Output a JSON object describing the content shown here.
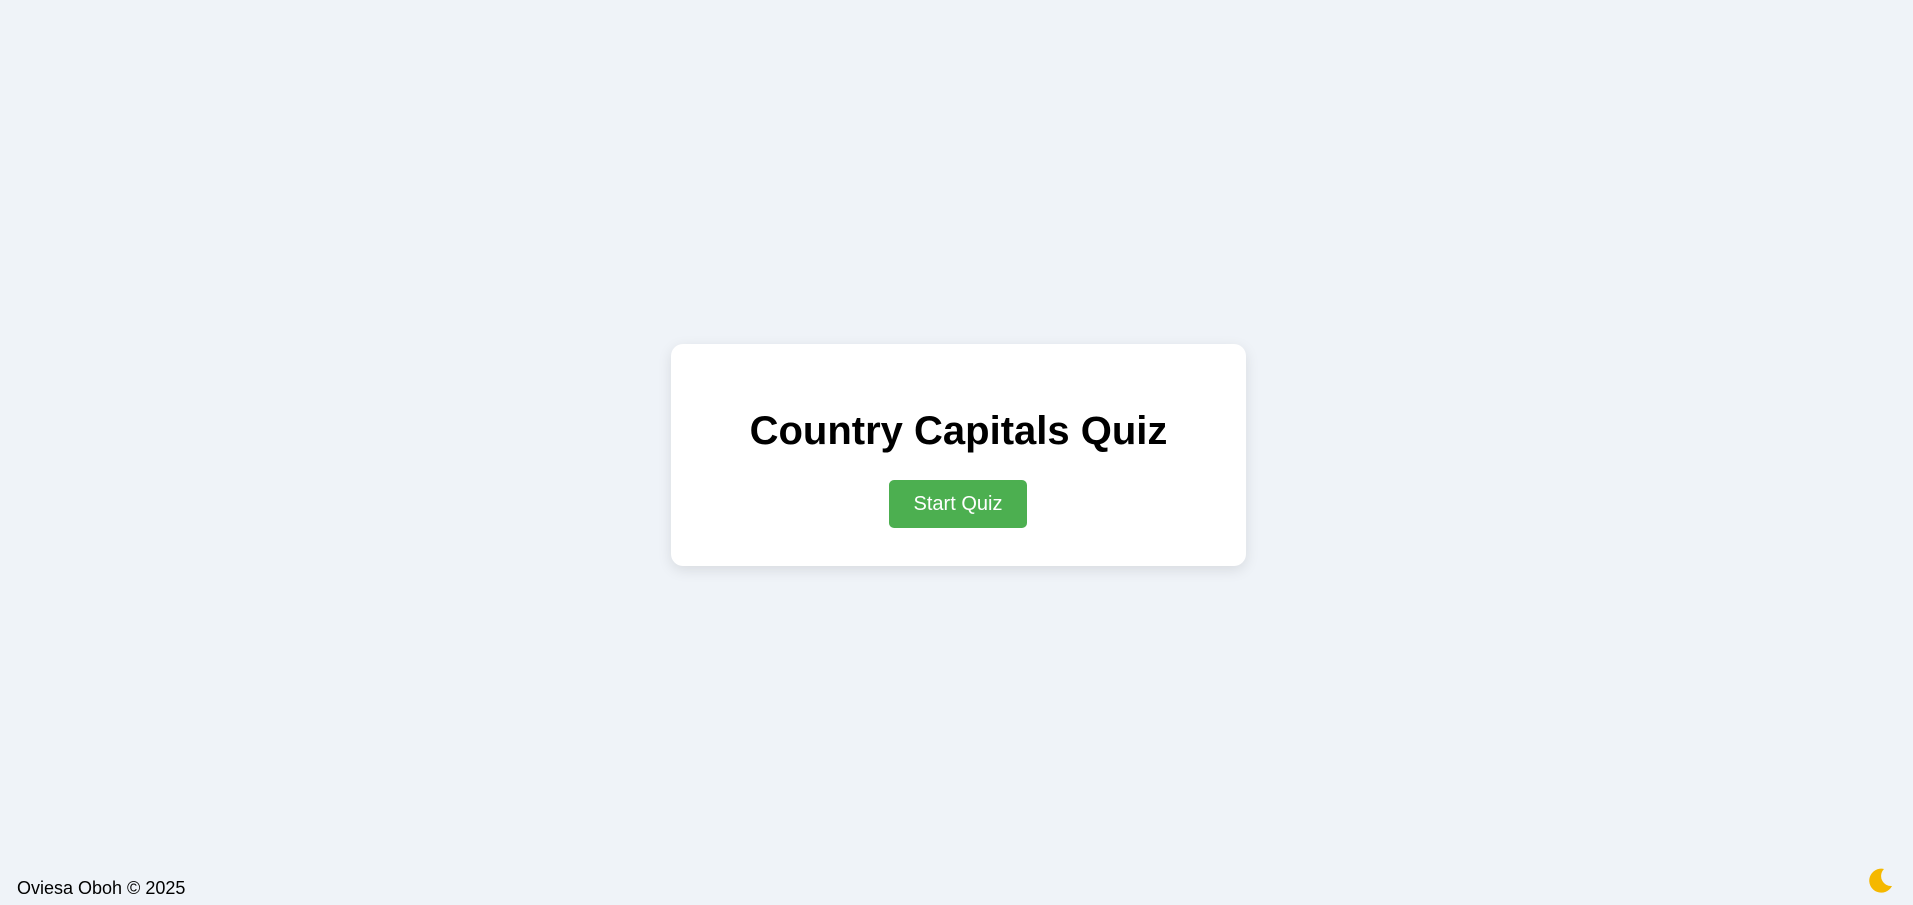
{
  "quiz": {
    "title": "Country Capitals Quiz",
    "start_label": "Start Quiz"
  },
  "footer": {
    "text": "Oviesa Oboh © 2025"
  },
  "theme_toggle": {
    "icon": "moon-icon",
    "color": "#f5b800"
  },
  "colors": {
    "background": "#eff3f8",
    "card": "#ffffff",
    "button": "#4caf50",
    "button_text": "#ffffff"
  }
}
